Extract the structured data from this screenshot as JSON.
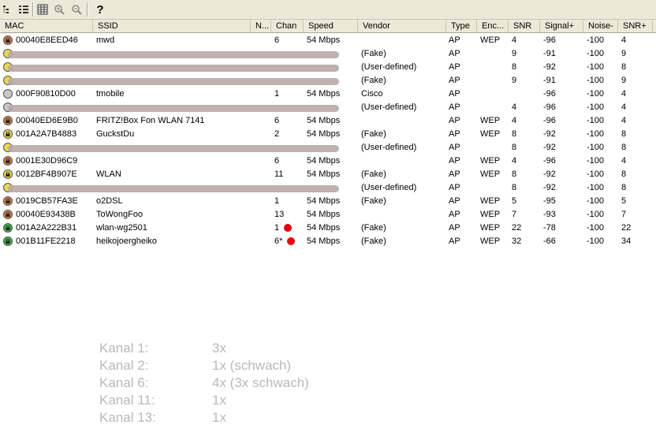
{
  "toolbar": {
    "buttons": [
      {
        "icon": "tree-view-icon"
      },
      {
        "icon": "list-view-icon"
      },
      {
        "icon": "grid-view-icon"
      },
      {
        "icon": "zoom-in-icon"
      },
      {
        "icon": "zoom-out-icon"
      },
      {
        "icon": "help-icon",
        "label": "?"
      }
    ]
  },
  "columns": [
    "MAC",
    "SSID",
    "N...",
    "Chan",
    "Speed",
    "Vendor",
    "Type",
    "Enc...",
    "SNR",
    "Signal+",
    "Noise-",
    "SNR+"
  ],
  "colors": {
    "locked_brown": "#c87a4a",
    "locked_yellow": "#e8d84a",
    "locked_green": "#3cb043",
    "unknown_grey": "#c8c8c8",
    "redaction": "#b8a8a8",
    "signal_dot": "#e8000c"
  },
  "rows": [
    {
      "mac": "00040E8EED46",
      "ssid": "mwd",
      "chan": "6",
      "speed": "54 Mbps",
      "vendor": "",
      "type": "AP",
      "enc": "WEP",
      "snr": "4",
      "signal": "-96",
      "noise": "-100",
      "snr_plus": "4",
      "icon": "brown",
      "lock": true,
      "redacted": false
    },
    {
      "mac": "",
      "ssid": "",
      "chan": "",
      "speed": "",
      "vendor": "(Fake)",
      "type": "AP",
      "enc": "",
      "snr": "9",
      "signal": "-91",
      "noise": "-100",
      "snr_plus": "9",
      "icon": "yellow",
      "lock": false,
      "redacted": true
    },
    {
      "mac": "",
      "ssid": "",
      "chan": "",
      "speed": "",
      "vendor": "(User-defined)",
      "type": "AP",
      "enc": "",
      "snr": "8",
      "signal": "-92",
      "noise": "-100",
      "snr_plus": "8",
      "icon": "yellow",
      "lock": false,
      "redacted": true
    },
    {
      "mac": "",
      "ssid": "",
      "chan": "",
      "speed": "",
      "vendor": "(Fake)",
      "type": "AP",
      "enc": "",
      "snr": "9",
      "signal": "-91",
      "noise": "-100",
      "snr_plus": "9",
      "icon": "yellow",
      "lock": false,
      "redacted": true
    },
    {
      "mac": "000F90810D00",
      "ssid": "tmobile",
      "chan": "1",
      "speed": "54 Mbps",
      "vendor": "Cisco",
      "type": "AP",
      "enc": "",
      "snr": "",
      "signal": "-96",
      "noise": "-100",
      "snr_plus": "4",
      "icon": "grey",
      "lock": false,
      "redacted": false
    },
    {
      "mac": "",
      "ssid": "",
      "chan": "",
      "speed": "",
      "vendor": "(User-defined)",
      "type": "AP",
      "enc": "",
      "snr": "4",
      "signal": "-96",
      "noise": "-100",
      "snr_plus": "4",
      "icon": "grey",
      "lock": false,
      "redacted": true
    },
    {
      "mac": "00040ED6E9B0",
      "ssid": "FRITZ!Box Fon WLAN 7141",
      "chan": "6",
      "speed": "54 Mbps",
      "vendor": "",
      "type": "AP",
      "enc": "WEP",
      "snr": "4",
      "signal": "-96",
      "noise": "-100",
      "snr_plus": "4",
      "icon": "brown",
      "lock": true,
      "redacted": false
    },
    {
      "mac": "001A2A7B4883",
      "ssid": "GuckstDu",
      "chan": "2",
      "speed": "54 Mbps",
      "vendor": "(Fake)",
      "type": "AP",
      "enc": "WEP",
      "snr": "8",
      "signal": "-92",
      "noise": "-100",
      "snr_plus": "8",
      "icon": "yellow",
      "lock": true,
      "redacted": false
    },
    {
      "mac": "",
      "ssid": "",
      "chan": "",
      "speed": "",
      "vendor": "(User-defined)",
      "type": "AP",
      "enc": "",
      "snr": "8",
      "signal": "-92",
      "noise": "-100",
      "snr_plus": "8",
      "icon": "yellow",
      "lock": false,
      "redacted": true
    },
    {
      "mac": "0001E30D96C9",
      "ssid": "",
      "chan": "6",
      "speed": "54 Mbps",
      "vendor": "",
      "type": "AP",
      "enc": "WEP",
      "snr": "4",
      "signal": "-96",
      "noise": "-100",
      "snr_plus": "4",
      "icon": "brown",
      "lock": true,
      "redacted": false
    },
    {
      "mac": "0012BF4B907E",
      "ssid": "WLAN",
      "chan": "11",
      "speed": "54 Mbps",
      "vendor": "(Fake)",
      "type": "AP",
      "enc": "WEP",
      "snr": "8",
      "signal": "-92",
      "noise": "-100",
      "snr_plus": "8",
      "icon": "yellow",
      "lock": true,
      "redacted": false
    },
    {
      "mac": "",
      "ssid": "",
      "chan": "",
      "speed": "",
      "vendor": "(User-defined)",
      "type": "AP",
      "enc": "",
      "snr": "8",
      "signal": "-92",
      "noise": "-100",
      "snr_plus": "8",
      "icon": "yellow",
      "lock": false,
      "redacted": true
    },
    {
      "mac": "0019CB57FA3E",
      "ssid": "o2DSL",
      "chan": "1",
      "speed": "54 Mbps",
      "vendor": "(Fake)",
      "type": "AP",
      "enc": "WEP",
      "snr": "5",
      "signal": "-95",
      "noise": "-100",
      "snr_plus": "5",
      "icon": "brown",
      "lock": true,
      "redacted": false
    },
    {
      "mac": "00040E93438B",
      "ssid": "ToWongFoo",
      "chan": "13",
      "speed": "54 Mbps",
      "vendor": "",
      "type": "AP",
      "enc": "WEP",
      "snr": "7",
      "signal": "-93",
      "noise": "-100",
      "snr_plus": "7",
      "icon": "brown",
      "lock": true,
      "redacted": false
    },
    {
      "mac": "001A2A222B31",
      "ssid": "wlan-wg2501",
      "chan": "1",
      "speed": "54 Mbps",
      "vendor": "(Fake)",
      "type": "AP",
      "enc": "WEP",
      "snr": "22",
      "signal": "-78",
      "noise": "-100",
      "snr_plus": "22",
      "icon": "green",
      "lock": true,
      "redacted": false,
      "dot": true
    },
    {
      "mac": "001B11FE2218",
      "ssid": "heikojoergheiko",
      "chan": "6*",
      "speed": "54 Mbps",
      "vendor": "(Fake)",
      "type": "AP",
      "enc": "WEP",
      "snr": "32",
      "signal": "-66",
      "noise": "-100",
      "snr_plus": "34",
      "icon": "green",
      "lock": true,
      "redacted": false,
      "dot": true
    }
  ],
  "notes": [
    {
      "label": "Kanal 1:",
      "value": "3x"
    },
    {
      "label": "Kanal 2:",
      "value": "1x (schwach)"
    },
    {
      "label": "Kanal 6:",
      "value": "4x (3x schwach)"
    },
    {
      "label": "Kanal 11:",
      "value": "1x"
    },
    {
      "label": "Kanal 13:",
      "value": "1x"
    }
  ]
}
